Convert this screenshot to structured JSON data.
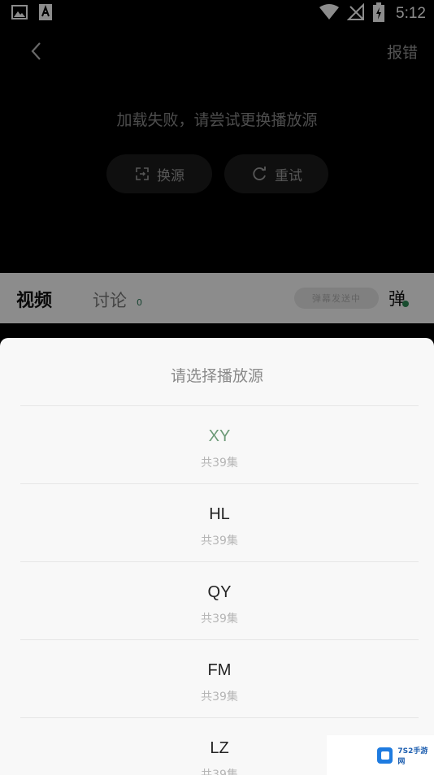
{
  "status_bar": {
    "time": "5:12",
    "icons": [
      "image-icon",
      "text-a-icon",
      "wifi-icon",
      "no-signal-icon",
      "battery-charging-icon"
    ]
  },
  "player": {
    "report_label": "报错",
    "error_message": "加载失败，请尝试更换播放源",
    "switch_source_label": "换源",
    "retry_label": "重试"
  },
  "tabs": {
    "video_label": "视频",
    "discuss_label": "讨论",
    "discuss_count": "0",
    "danmaku_placeholder": "弹幕发送中",
    "danmaku_toggle": "弹"
  },
  "sheet": {
    "title": "请选择播放源",
    "sources": [
      {
        "name": "XY",
        "count": "共39集",
        "active": true
      },
      {
        "name": "HL",
        "count": "共39集",
        "active": false
      },
      {
        "name": "QY",
        "count": "共39集",
        "active": false
      },
      {
        "name": "FM",
        "count": "共39集",
        "active": false
      },
      {
        "name": "LZ",
        "count": "共39集",
        "active": false
      }
    ]
  },
  "watermark": {
    "text": "7S2手游网"
  }
}
